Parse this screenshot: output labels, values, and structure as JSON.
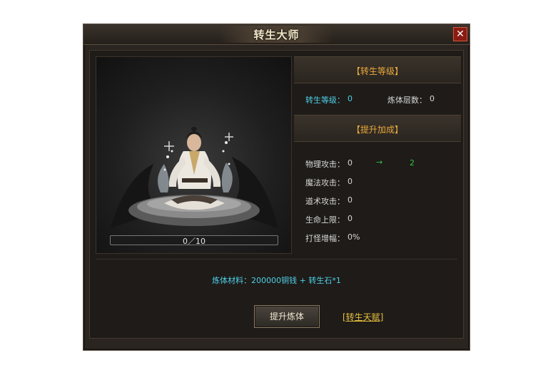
{
  "window": {
    "title": "转生大师",
    "close_label": "✕"
  },
  "progress": {
    "text": "0／10",
    "fraction": 0
  },
  "rebirth_section": {
    "header": "【转生等级】"
  },
  "rebirth_stats": {
    "level_label": "转生等级：",
    "level_value": "0",
    "refine_label": "炼体层数：",
    "refine_value": "0"
  },
  "bonus_section": {
    "header": "【提升加成】"
  },
  "bonus_stats": [
    {
      "label": "物理攻击：",
      "value": "0",
      "arrow": "→",
      "next": "2"
    },
    {
      "label": "魔法攻击：",
      "value": "0"
    },
    {
      "label": "道术攻击：",
      "value": "0"
    },
    {
      "label": "生命上限：",
      "value": "0"
    },
    {
      "label": "打怪增幅：",
      "value": "0%"
    }
  ],
  "material": {
    "text": "炼体材料：200000铜钱 + 转生石*1"
  },
  "actions": {
    "upgrade_label": "提升炼体",
    "talent_link": "[转生天赋]"
  },
  "colors": {
    "accent_gold": "#e8a93c",
    "cyan": "#4fd0e8",
    "green": "#35c24a",
    "link": "#e6c040"
  }
}
